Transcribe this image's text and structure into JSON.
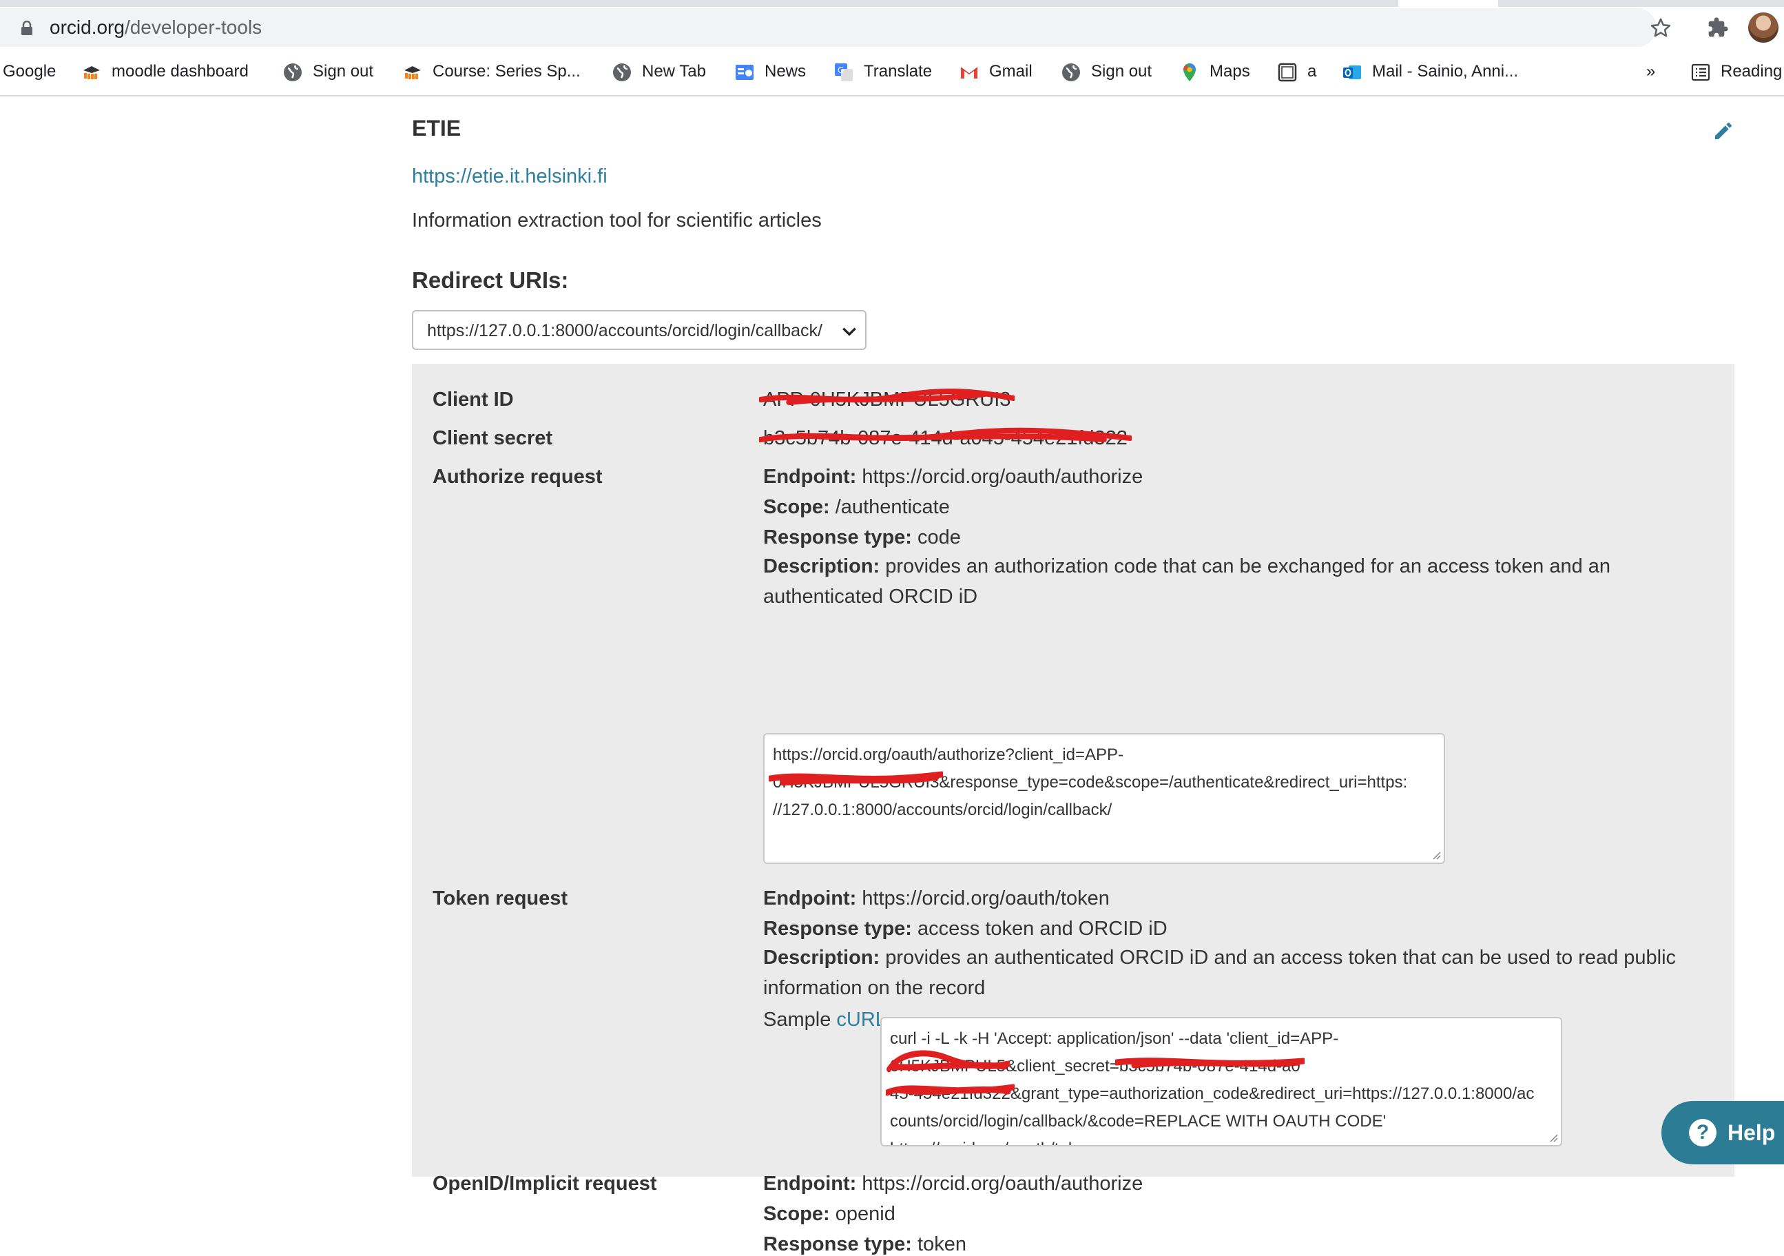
{
  "browser": {
    "url_domain": "orcid.org",
    "url_path": "/developer-tools",
    "bookmarks": [
      {
        "label": "Google",
        "icon": "none"
      },
      {
        "label": "moodle dashboard",
        "icon": "moodle-icon"
      },
      {
        "label": "Sign out",
        "icon": "globe-icon"
      },
      {
        "label": "Course: Series Sp...",
        "icon": "moodle-icon"
      },
      {
        "label": "New Tab",
        "icon": "globe-icon"
      },
      {
        "label": "News",
        "icon": "google-news-icon"
      },
      {
        "label": "Translate",
        "icon": "google-translate-icon"
      },
      {
        "label": "Gmail",
        "icon": "gmail-icon"
      },
      {
        "label": "Sign out",
        "icon": "globe-icon"
      },
      {
        "label": "Maps",
        "icon": "maps-pin-icon"
      },
      {
        "label": "a",
        "icon": "page-icon"
      },
      {
        "label": "Mail - Sainio, Anni...",
        "icon": "outlook-icon"
      }
    ],
    "overflow_label": "»",
    "reading_list_label": "Reading"
  },
  "app": {
    "name": "ETIE",
    "url": "https://etie.it.helsinki.fi",
    "description": "Information extraction tool for scientific articles",
    "redirect_heading": "Redirect URIs:",
    "redirect_selected": "https://127.0.0.1:8000/accounts/orcid/login/callback/"
  },
  "details": {
    "client_id_label": "Client ID",
    "client_id_value": "APP-0H5KJBMPUL5GRUI3",
    "client_secret_label": "Client secret",
    "client_secret_value": "b3c5b74b-087e-414d-a045-454e21fd322",
    "authorize": {
      "label": "Authorize request",
      "endpoint_key": "Endpoint:",
      "endpoint": "https://orcid.org/oauth/authorize",
      "scope_key": "Scope:",
      "scope": "/authenticate",
      "response_key": "Response type:",
      "response": "code",
      "description_key": "Description:",
      "description": "provides an authorization code that can be exchanged for an access token and an authenticated ORCID iD",
      "sample_line1": "https://orcid.org/oauth/authorize?client_id=APP-",
      "sample_redacted": "0H5KJBMPUL5GRUI3",
      "sample_line2": "&response_type=code&scope=/authenticate&redirect_uri=https:",
      "sample_line3": "//127.0.0.1:8000/accounts/orcid/login/callback/"
    },
    "token": {
      "label": "Token request",
      "endpoint_key": "Endpoint:",
      "endpoint": "https://orcid.org/oauth/token",
      "response_key": "Response type:",
      "response": "access token and ORCID iD",
      "description_key": "Description:",
      "description": "provides an authenticated ORCID iD and an access token that can be used to read public information on the record",
      "sample_prefix": "Sample",
      "sample_link": "cURL",
      "curl_line1": "curl -i -L -k -H 'Accept: application/json' --data 'client_id=APP-",
      "curl_red1": "0H5KJBMPUL5",
      "curl_line2": "&client_secret=",
      "curl_red2": "b3c5b74b-087e-414d-a0",
      "curl_red3": "45-454e21fd322",
      "curl_line3": "&grant_type=authorization_code&redirect_uri=https://127.0.0.1:8000/ac",
      "curl_line4": "counts/orcid/login/callback/&code=REPLACE WITH OAUTH CODE'",
      "curl_line5": "https://orcid.org/oauth/token"
    },
    "openid": {
      "label": "OpenID/Implicit request",
      "endpoint_key": "Endpoint:",
      "endpoint": "https://orcid.org/oauth/authorize",
      "scope_key": "Scope:",
      "scope": "openid",
      "response_key": "Response type:",
      "response": "token"
    }
  },
  "help": {
    "label": "Help"
  },
  "colors": {
    "link": "#2e7f9f",
    "panel": "#ebebeb",
    "redaction": "#e02020",
    "help": "#2d7c95"
  }
}
